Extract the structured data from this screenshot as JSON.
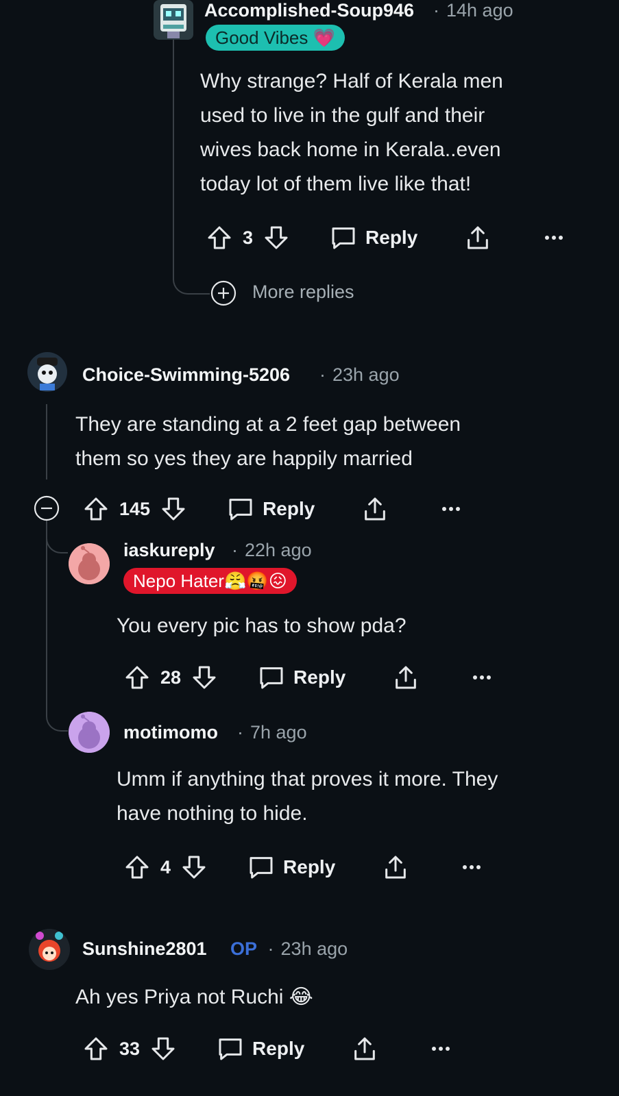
{
  "comments": [
    {
      "username": "Accomplished-Soup946",
      "time": "14h ago",
      "flair": "Good Vibes 💗",
      "flair_color": "#1dbfb0",
      "text_lines": [
        "Why strange? Half of Kerala men",
        "used to live in the gulf and their",
        "wives back home in Kerala..even",
        "today lot of them live like that!"
      ],
      "votes": "3",
      "reply_label": "Reply",
      "more_replies": "More replies"
    },
    {
      "username": "Choice-Swimming-5206",
      "time": "23h ago",
      "text_lines": [
        "They are standing at a 2 feet gap between",
        "them so yes they are happily married"
      ],
      "votes": "145",
      "reply_label": "Reply"
    },
    {
      "username": "iaskureply",
      "time": "22h ago",
      "flair": "Nepo Hater😤🤬😖",
      "flair_color": "#e0162b",
      "text_lines": [
        "You every pic has to show pda?"
      ],
      "votes": "28",
      "reply_label": "Reply"
    },
    {
      "username": "motimomo",
      "time": "7h ago",
      "text_lines": [
        "Umm if anything that proves it more. They",
        "have nothing to hide."
      ],
      "votes": "4",
      "reply_label": "Reply"
    },
    {
      "username": "Sunshine2801",
      "op_badge": "OP",
      "time": "23h ago",
      "text_lines": [
        "Ah yes Priya not Ruchi 😂"
      ],
      "votes": "33",
      "reply_label": "Reply"
    }
  ],
  "icons": [
    "upvote-icon",
    "downvote-icon",
    "comment-icon",
    "share-icon",
    "more-options-icon",
    "expand-plus-icon",
    "collapse-minus-icon"
  ]
}
